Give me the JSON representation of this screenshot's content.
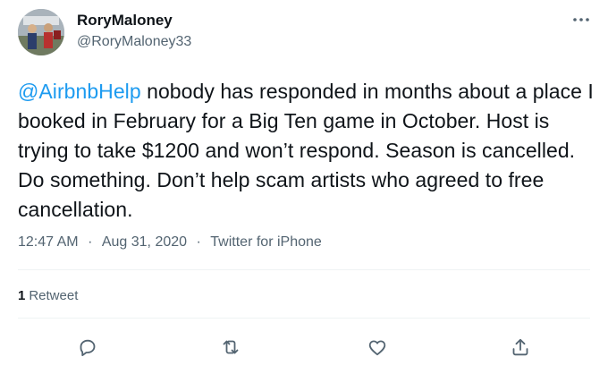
{
  "user": {
    "display_name": "RoryMaloney",
    "handle": "@RoryMaloney33"
  },
  "tweet": {
    "mention": "@AirbnbHelp",
    "text": " nobody has responded in months about a place I booked in February for a Big Ten game in October. Host is trying to take $1200 and won’t respond. Season is cancelled. Do something. Don’t help scam artists who agreed to free cancellation."
  },
  "meta": {
    "time": "12:47 AM",
    "separator": "·",
    "date": "Aug 31, 2020",
    "source": "Twitter for iPhone"
  },
  "stats": {
    "retweet_count": "1",
    "retweet_label": "Retweet"
  },
  "icons": {
    "more": "more-icon",
    "reply": "reply-icon",
    "retweet": "retweet-icon",
    "like": "like-icon",
    "share": "share-icon"
  },
  "colors": {
    "mention": "#1d9bf0",
    "text": "#0f1419",
    "secondary": "#536471",
    "divider": "#eff3f4"
  }
}
